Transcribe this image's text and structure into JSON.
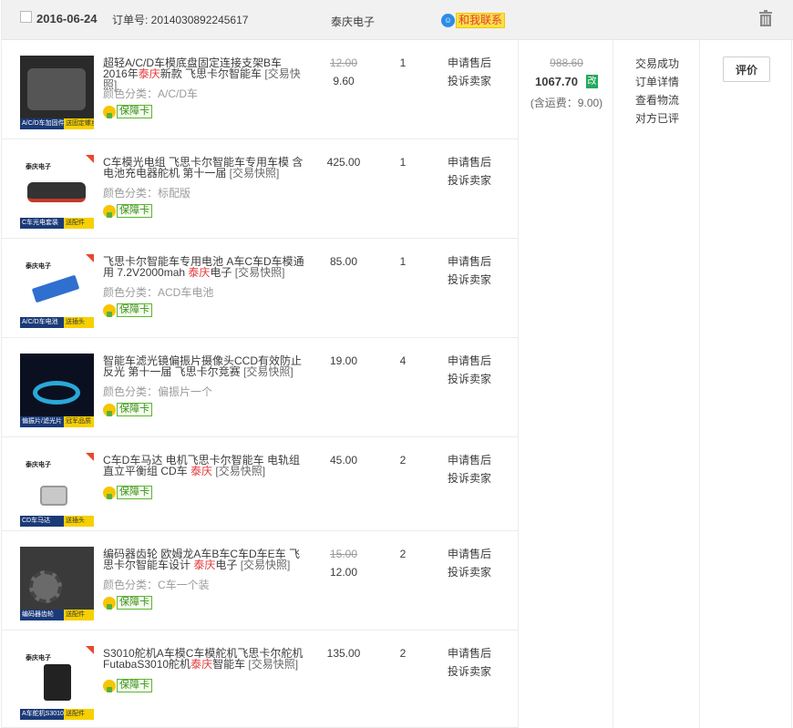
{
  "order": {
    "date": "2016-06-24",
    "order_no_label": "订单号: 2014030892245617",
    "shop": "泰庆电子",
    "contact_label": "和我联系",
    "contact_icon": "chat-bubble-icon",
    "total": {
      "original": "988.60",
      "paid": "1067.70",
      "modified_tag": "改",
      "shipping": "(含运费：9.00)"
    },
    "status_links": [
      "交易成功",
      "订单详情",
      "查看物流",
      "对方已评"
    ],
    "action_button": "评价"
  },
  "items": [
    {
      "title_parts": [
        "超轻A/C/D车模底盘固定连接支架B车2016年",
        "泰庆",
        "新款 飞思卡尔智能车 "
      ],
      "snapshot": "[交易快照]",
      "sku": "颜色分类：A/C/D车",
      "badge": "保障卡",
      "price_original": "12.00",
      "price_now": "9.60",
      "qty": "1",
      "ops": [
        "申请售后",
        "投诉卖家"
      ],
      "thumb_strip": [
        "A/C/D车加固件",
        "送固定螺丝"
      ]
    },
    {
      "title_parts": [
        "C车模光电组 飞思卡尔智能车专用车模 含电池充电器舵机 第十一届 ",
        "",
        ""
      ],
      "snapshot": "[交易快照]",
      "sku": "颜色分类：标配版",
      "badge": "保障卡",
      "price_original": "",
      "price_now": "425.00",
      "qty": "1",
      "ops": [
        "申请售后",
        "投诉卖家"
      ],
      "thumb_strip": [
        "C车光电套装",
        "送配件"
      ]
    },
    {
      "title_parts": [
        "飞思卡尔智能车专用电池 A车C车D车模通用 7.2V2000mah ",
        "泰庆",
        "电子 "
      ],
      "snapshot": "[交易快照]",
      "sku": "颜色分类：ACD车电池",
      "badge": "保障卡",
      "price_original": "",
      "price_now": "85.00",
      "qty": "1",
      "ops": [
        "申请售后",
        "投诉卖家"
      ],
      "thumb_strip": [
        "A/C/D车电池",
        "送插头"
      ]
    },
    {
      "title_parts": [
        "智能车滤光镜偏振片摄像头CCD有效防止反光 第十一届 飞思卡尔竞赛 ",
        "",
        ""
      ],
      "snapshot": "[交易快照]",
      "sku": "颜色分类：偏振片一个",
      "badge": "保障卡",
      "price_original": "",
      "price_now": "19.00",
      "qty": "4",
      "ops": [
        "申请售后",
        "投诉卖家"
      ],
      "thumb_strip": [
        "偏振片/滤光片",
        "冠军品质"
      ]
    },
    {
      "title_parts": [
        "C车D车马达 电机飞思卡尔智能车 电轨组 直立平衡组 CD车 ",
        "泰庆",
        " "
      ],
      "snapshot": "[交易快照]",
      "sku": "",
      "badge": "保障卡",
      "price_original": "",
      "price_now": "45.00",
      "qty": "2",
      "ops": [
        "申请售后",
        "投诉卖家"
      ],
      "thumb_strip": [
        "CD车马达",
        "送插头"
      ]
    },
    {
      "title_parts": [
        "编码器齿轮 欧姆龙A车B车C车D车E车 飞思卡尔智能车设计 ",
        "泰庆",
        "电子 "
      ],
      "snapshot": "[交易快照]",
      "sku": "颜色分类：C车一个装",
      "badge": "保障卡",
      "price_original": "15.00",
      "price_now": "12.00",
      "qty": "2",
      "ops": [
        "申请售后",
        "投诉卖家"
      ],
      "thumb_strip": [
        "编码器齿轮",
        "送配件"
      ]
    },
    {
      "title_parts": [
        "S3010舵机A车模C车模舵机飞思卡尔舵机FutabaS3010舵机",
        "泰庆",
        "智能车 "
      ],
      "snapshot": "[交易快照]",
      "sku": "",
      "badge": "保障卡",
      "price_original": "",
      "price_now": "135.00",
      "qty": "2",
      "ops": [
        "申请售后",
        "投诉卖家"
      ],
      "thumb_strip": [
        "A车舵机S3010",
        "送配件"
      ]
    }
  ],
  "thumb_logo": "泰庆电子",
  "colors": {
    "highlight": "#e4393c",
    "header_bg": "#f1f1f1",
    "border": "#ececec",
    "muted": "#9c9c9c"
  }
}
